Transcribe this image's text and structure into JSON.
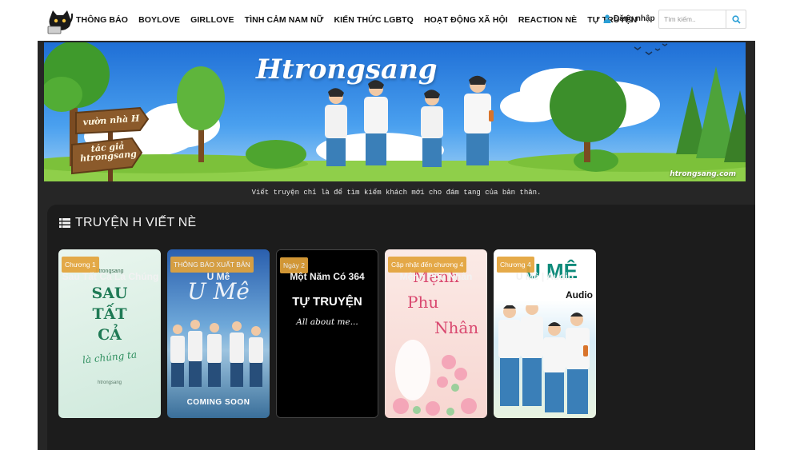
{
  "nav": {
    "menu": [
      "THÔNG BÁO",
      "BOYLOVE",
      "GIRLLOVE",
      "TÌNH CẢM NAM NỮ",
      "KIẾN THỨC LGBTQ",
      "HOẠT ĐỘNG XÃ HỘI",
      "REACTION NÈ",
      "TỰ TRUYỆN"
    ],
    "login_label": "Đăng nhập",
    "search_placeholder": "Tìm kiếm..",
    "icons": {
      "user": "user-icon",
      "search": "search-icon",
      "logo": "cat-logo-icon"
    }
  },
  "banner": {
    "title": "Htrongsang",
    "sign_top": "vườn nhà H",
    "sign_bottom_line1": "tác giả",
    "sign_bottom_line2": "htrongsang",
    "url": "htrongsang.com",
    "tagline": "Viết truyện chỉ là để tìm kiếm khách mới cho đám tang của bản thân."
  },
  "section": {
    "icon": "list-icon",
    "title": "TRUYỆN H VIẾT NÈ",
    "stories": [
      {
        "badge": "Chương 1",
        "title": "Sau Tất Cả Là Chúng",
        "cover_author": "htrongsang",
        "cover_l1": "SAU",
        "cover_l2": "TẤT",
        "cover_l3": "CẢ",
        "cover_l4": "là chúng ta",
        "cover_credit": "htrongsang"
      },
      {
        "badge": "THÔNG BÁO XUẤT BẢN",
        "title": "U Mê",
        "cover_title": "U Mê",
        "cover_foot": "COMING SOON"
      },
      {
        "badge": "Ngày 2",
        "title": "Một Năm Có 364",
        "cover_l1": "TỰ TRUYỆN",
        "cover_l2": "All about me..."
      },
      {
        "badge": "Cập nhật đến chương 4",
        "title": "Mệnh Phu Nhân",
        "cover_l1": "Mệnh",
        "cover_l2": "Phu",
        "cover_l3": "Nhân"
      },
      {
        "badge": "Chương 4",
        "title": "U Mê | Audio",
        "cover_l1": "U MÊ",
        "cover_l2": "Audio"
      }
    ]
  }
}
